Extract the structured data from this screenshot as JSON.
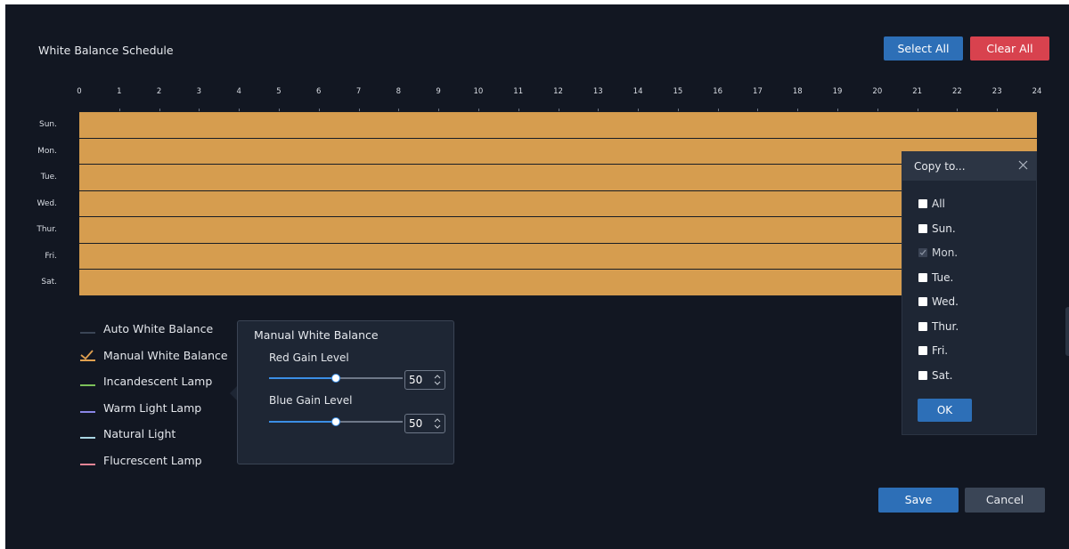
{
  "header": {
    "title": "White Balance Schedule",
    "select_all_label": "Select All",
    "clear_all_label": "Clear All"
  },
  "timeline": {
    "hours": [
      "0",
      "1",
      "2",
      "3",
      "4",
      "5",
      "6",
      "7",
      "8",
      "9",
      "10",
      "11",
      "12",
      "13",
      "14",
      "15",
      "16",
      "17",
      "18",
      "19",
      "20",
      "21",
      "22",
      "23",
      "24"
    ],
    "days": [
      "Sun.",
      "Mon.",
      "Tue.",
      "Wed.",
      "Thur.",
      "Fri.",
      "Sat."
    ],
    "fill_color": "#d69d4f"
  },
  "legend": [
    {
      "label": "Auto White Balance",
      "color": "#3a4556",
      "selected": false
    },
    {
      "label": "Manual White Balance",
      "color": "#e0a050",
      "selected": true
    },
    {
      "label": "Incandescent Lamp",
      "color": "#7cc15a",
      "selected": false
    },
    {
      "label": "Warm Light Lamp",
      "color": "#8a86e6",
      "selected": false
    },
    {
      "label": "Natural Light",
      "color": "#a9d6e3",
      "selected": false
    },
    {
      "label": "Flucrescent Lamp",
      "color": "#e58596",
      "selected": false
    }
  ],
  "manual_wb": {
    "title": "Manual White Balance",
    "red_gain_label": "Red Gain Level",
    "red_gain_value": "50",
    "blue_gain_label": "Blue Gain Level",
    "blue_gain_value": "50"
  },
  "copy_to": {
    "title": "Copy to...",
    "items": [
      {
        "label": "All",
        "checked": false,
        "disabled": false
      },
      {
        "label": "Sun.",
        "checked": false,
        "disabled": false
      },
      {
        "label": "Mon.",
        "checked": true,
        "disabled": true
      },
      {
        "label": "Tue.",
        "checked": false,
        "disabled": false
      },
      {
        "label": "Wed.",
        "checked": false,
        "disabled": false
      },
      {
        "label": "Thur.",
        "checked": false,
        "disabled": false
      },
      {
        "label": "Fri.",
        "checked": false,
        "disabled": false
      },
      {
        "label": "Sat.",
        "checked": false,
        "disabled": false
      }
    ],
    "ok_label": "OK"
  },
  "footer": {
    "save_label": "Save",
    "cancel_label": "Cancel"
  },
  "colors": {
    "background": "#121722",
    "primary": "#2d6fb7",
    "danger": "#d8424e",
    "accent": "#3b8ee5"
  }
}
